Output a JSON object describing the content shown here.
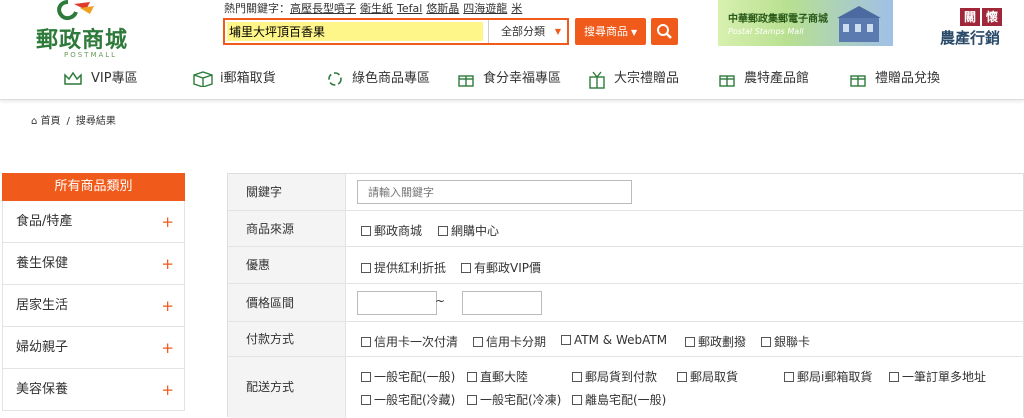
{
  "brand": {
    "name": "郵政商城",
    "sub": "POSTMALL",
    "colors": {
      "accent": "#f05a1a",
      "brand_green": "#2d7a3a",
      "highlight": "#fff68a"
    }
  },
  "header": {
    "hot_label": "熱門關鍵字：",
    "hot_keywords": [
      "高壓長型噴子",
      "衛生紙",
      "Tefal",
      "悠斯晶",
      "四海遊龍",
      "米"
    ],
    "search": {
      "value": "埔里大坪頂百香果",
      "placeholder": ""
    },
    "category_select": "全部分類",
    "search_button": "搜尋商品",
    "banner": {
      "title": "中華郵政集郵電子商城",
      "subtitle": "Postal Stamps Mall"
    },
    "care": {
      "top": [
        "關",
        "懷"
      ],
      "bottom": "農產行銷"
    }
  },
  "nav": [
    {
      "label": "VIP專區",
      "icon": "crown-icon"
    },
    {
      "label": "i郵箱取貨",
      "icon": "box-icon"
    },
    {
      "label": "綠色商品專區",
      "icon": "recycle-icon"
    },
    {
      "label": "食分幸福專區",
      "icon": "gift-icon"
    },
    {
      "label": "大宗禮贈品",
      "icon": "gift-box-icon"
    },
    {
      "label": "農特產品館",
      "icon": "gift-icon"
    },
    {
      "label": "禮贈品兌換",
      "icon": "gift-icon"
    }
  ],
  "breadcrumb": {
    "home": "首頁",
    "sep": "/",
    "current": "搜尋結果"
  },
  "sidebar": {
    "title": "所有商品類別",
    "items": [
      {
        "label": "食品/特產"
      },
      {
        "label": "養生保健"
      },
      {
        "label": "居家生活"
      },
      {
        "label": "婦幼親子"
      },
      {
        "label": "美容保養"
      }
    ],
    "expand_symbol": "+"
  },
  "filters": {
    "keyword": {
      "label": "關鍵字",
      "placeholder": "請輸入關鍵字"
    },
    "source": {
      "label": "商品來源",
      "options": [
        "郵政商城",
        "網購中心"
      ]
    },
    "discount": {
      "label": "優惠",
      "options": [
        "提供紅利折抵",
        "有郵政VIP價"
      ]
    },
    "price": {
      "label": "價格區間",
      "separator": "~"
    },
    "payment": {
      "label": "付款方式",
      "options": [
        "信用卡一次付清",
        "信用卡分期",
        "ATM & WebATM",
        "郵政劃撥",
        "銀聯卡"
      ]
    },
    "delivery": {
      "label": "配送方式",
      "options_row1": [
        "一般宅配(一般)",
        "直郵大陸",
        "郵局貨到付款",
        "郵局取貨",
        "郵局i郵箱取貨",
        "一筆訂單多地址"
      ],
      "options_row2": [
        "一般宅配(冷藏)",
        "一般宅配(冷凍)",
        "離島宅配(一般)"
      ]
    }
  }
}
